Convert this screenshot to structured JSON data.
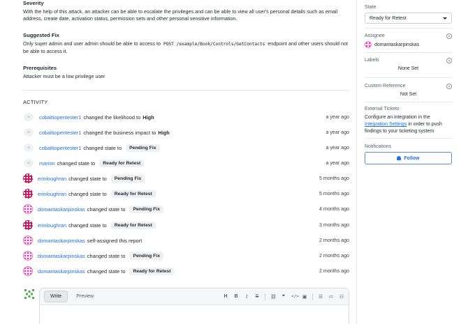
{
  "details": {
    "severity_heading": "Severity",
    "severity_text": "With the help of this attack, an attacker can be able to escalate the privileges and can be able to view all user's personal details such as email address, create date, activation status, permission sets and other personal sensitive information.",
    "fix_heading": "Suggested Fix",
    "fix_text_before": "Only super admin and user admin should be able to access to",
    "fix_code": "POST /example/Book/Controls/GetContacts",
    "fix_text_after": "endpoint and other users should not be able to access it.",
    "prereq_heading": "Prerequisites",
    "prereq_text": "Attacker must be a low privilege user"
  },
  "activity": {
    "title": "ACTIVITY",
    "items": [
      {
        "avatar": "small",
        "user": "cobaltiopentester1",
        "action": "changed the likelihood to",
        "value": "High",
        "value_style": "bold",
        "time": "a year ago"
      },
      {
        "avatar": "small",
        "user": "cobaltiopentester1",
        "action": "changed the business impact to",
        "value": "High",
        "value_style": "bold",
        "time": "a year ago"
      },
      {
        "avatar": "small",
        "user": "cobaltiopentester1",
        "action": "changed state to",
        "value": "Pending Fix",
        "value_style": "pill",
        "time": "a year ago"
      },
      {
        "avatar": "small",
        "user": "marion",
        "action": "changed state to",
        "value": "Ready for Retest",
        "value_style": "pill",
        "time": "a year ago"
      },
      {
        "avatar": "erin",
        "user": "erinloughran",
        "action": "changed state to",
        "value": "Pending Fix",
        "value_style": "pill",
        "time": "5 months ago"
      },
      {
        "avatar": "erin",
        "user": "erinloughran",
        "action": "changed state to",
        "value": "Ready for Retest",
        "value_style": "pill",
        "time": "5 months ago"
      },
      {
        "avatar": "dom",
        "user": "domantaskarpinskas",
        "action": "changed state to",
        "value": "Pending Fix",
        "value_style": "pill",
        "time": "4 months ago"
      },
      {
        "avatar": "erin",
        "user": "erinloughran",
        "action": "changed state to",
        "value": "Ready for Retest",
        "value_style": "pill",
        "time": "3 months ago"
      },
      {
        "avatar": "dom",
        "user": "domantaskarpinskas",
        "action": "self-assigned this report",
        "value": "",
        "value_style": "none",
        "time": "2 months ago"
      },
      {
        "avatar": "dom",
        "user": "domantaskarpinskas",
        "action": "changed state to",
        "value": "Pending Fix",
        "value_style": "pill",
        "time": "2 months ago"
      },
      {
        "avatar": "dom",
        "user": "domantaskarpinskas",
        "action": "changed state to",
        "value": "Ready for Retest",
        "value_style": "pill",
        "time": "2 months ago"
      }
    ]
  },
  "editor": {
    "write_tab": "Write",
    "preview_tab": "Preview",
    "tools": [
      "H",
      "B",
      "I",
      "S",
      "link",
      "quote",
      "code",
      "image",
      "bullet-list",
      "numbered-list",
      "task-list"
    ]
  },
  "sidebar": {
    "state_label": "State",
    "state_value": "Ready for Retest",
    "assignee_label": "Assignee",
    "assignee_value": "domantaskarpinskas",
    "labels_label": "Labels",
    "labels_value": "None Set",
    "custom_ref_label": "Custom Reference",
    "custom_ref_value": "Not Set",
    "external_label": "External Tickets",
    "external_text_before": "Configure an integration in the",
    "external_link": "Integration Settings",
    "external_text_after": "in order to push findings to your ticketing system",
    "notifications_label": "Notifications",
    "follow_label": "Follow"
  },
  "colors": {
    "link": "#1f6feb",
    "erin_avatar": "#c2185b",
    "dom_avatar": "#e879c0"
  }
}
